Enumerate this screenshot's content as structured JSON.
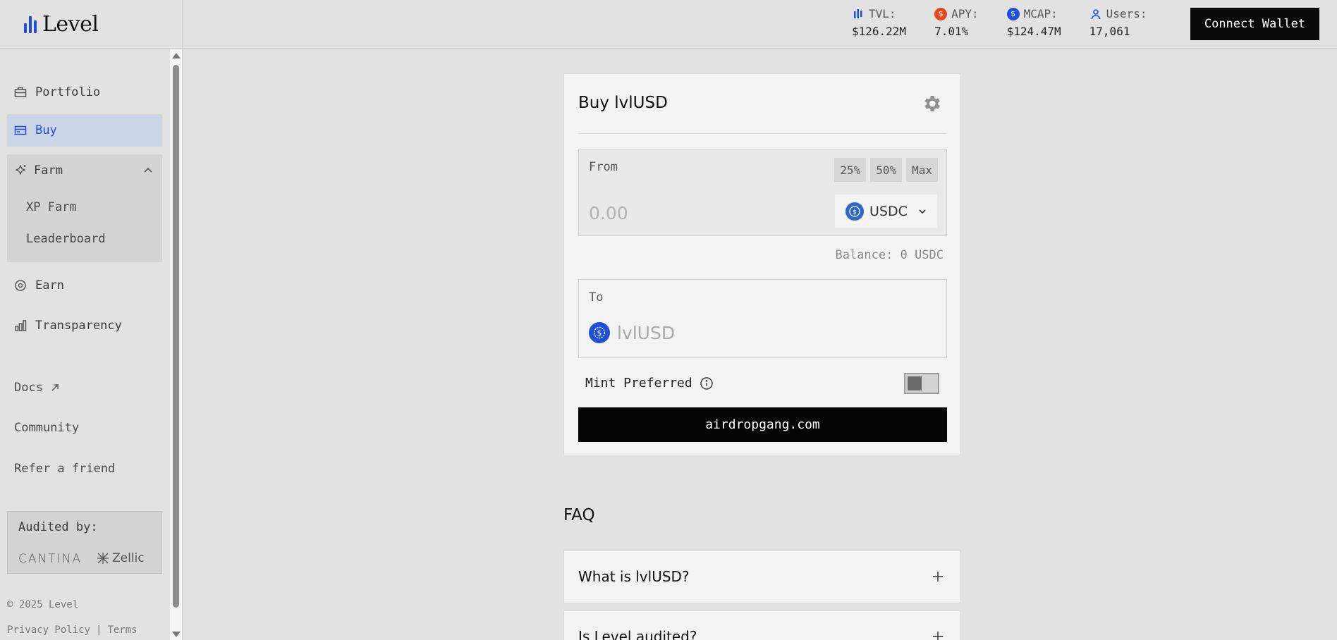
{
  "header": {
    "logo_text": "Level",
    "connect_button": "Connect Wallet",
    "stats": [
      {
        "label": "TVL:",
        "value": "$126.22M",
        "icon": "level-bars-icon",
        "color": "#1e4fd6"
      },
      {
        "label": "APY:",
        "value": "7.01%",
        "icon": "apy-coin-icon",
        "color": "#e5491b"
      },
      {
        "label": "MCAP:",
        "value": "$124.47M",
        "icon": "mcap-coin-icon",
        "color": "#1f4fd8"
      },
      {
        "label": "Users:",
        "value": "17,061",
        "icon": "user-icon",
        "color": "#1f4fd8"
      }
    ]
  },
  "sidebar": {
    "items": [
      {
        "label": "Portfolio",
        "icon": "briefcase-icon"
      },
      {
        "label": "Buy",
        "icon": "card-icon",
        "active": true
      },
      {
        "label": "Farm",
        "icon": "sparkle-icon",
        "expanded": true
      },
      {
        "label": "Earn",
        "icon": "target-icon"
      },
      {
        "label": "Transparency",
        "icon": "bar-chart-icon"
      }
    ],
    "farm_sub": [
      "XP Farm",
      "Leaderboard"
    ],
    "links": [
      "Docs",
      "Community",
      "Refer a friend"
    ],
    "audited_by": "Audited by:",
    "auditors": [
      "CANTINA",
      "Zellic"
    ],
    "copyright": "© 2025 Level",
    "footer_links": [
      "Privacy Policy",
      "|",
      "Terms"
    ]
  },
  "card": {
    "title": "Buy lvlUSD",
    "from_label": "From",
    "pct_buttons": [
      "25%",
      "50%",
      "Max"
    ],
    "amount_placeholder": "0.00",
    "from_token": "USDC",
    "balance": "Balance: 0 USDC",
    "to_label": "To",
    "to_token": "lvlUSD",
    "mint_preferred": "Mint Preferred",
    "mint_preferred_on": false,
    "action_button": "airdropgang.com"
  },
  "faq": {
    "title": "FAQ",
    "questions": [
      "What is lvlUSD?",
      "Is Level audited?"
    ]
  }
}
